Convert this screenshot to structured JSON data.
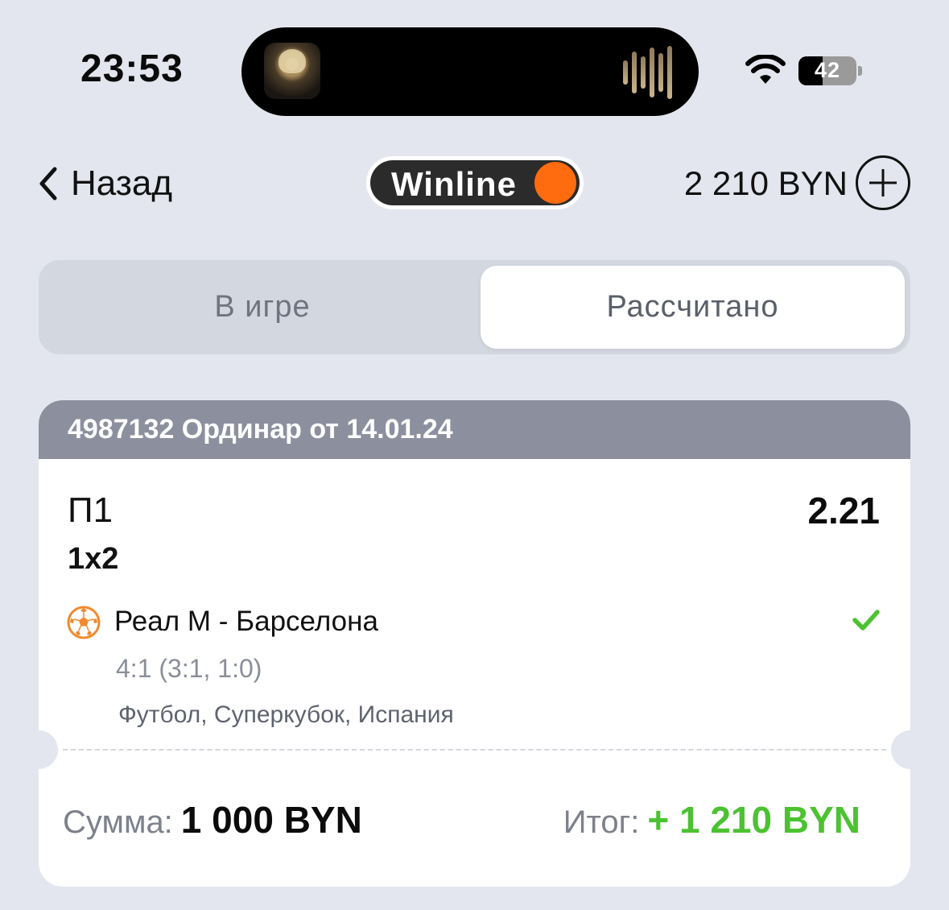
{
  "status_bar": {
    "time": "23:53",
    "battery": "42",
    "battery_level_percent": 42,
    "icons": [
      "now-playing-artwork",
      "audio-waveform",
      "wifi-icon",
      "battery-icon"
    ]
  },
  "nav": {
    "back_label": "Назад",
    "brand": "Winline",
    "balance": "2 210 BYN",
    "colors": {
      "brand_accent": "#ff6b0f",
      "brand_dark": "#2b2b2b"
    }
  },
  "tabs": [
    {
      "label": "В игре",
      "selected": false
    },
    {
      "label": "Рассчитано",
      "selected": true
    }
  ],
  "bet": {
    "header": "4987132 Ординар от 14.01.24",
    "outcome": "П1",
    "odds": "2.21",
    "market": "1x2",
    "match": "Реал М - Барселона",
    "score": "4:1 (3:1, 1:0)",
    "league": "Футбол, Суперкубок, Испания",
    "status": "won",
    "stake_label": "Сумма:",
    "stake_value": "1 000 BYN",
    "result_label": "Итог:",
    "result_value": "+ 1 210 BYN",
    "colors": {
      "header_bg": "#8c909e",
      "win_green": "#4cc233"
    }
  }
}
